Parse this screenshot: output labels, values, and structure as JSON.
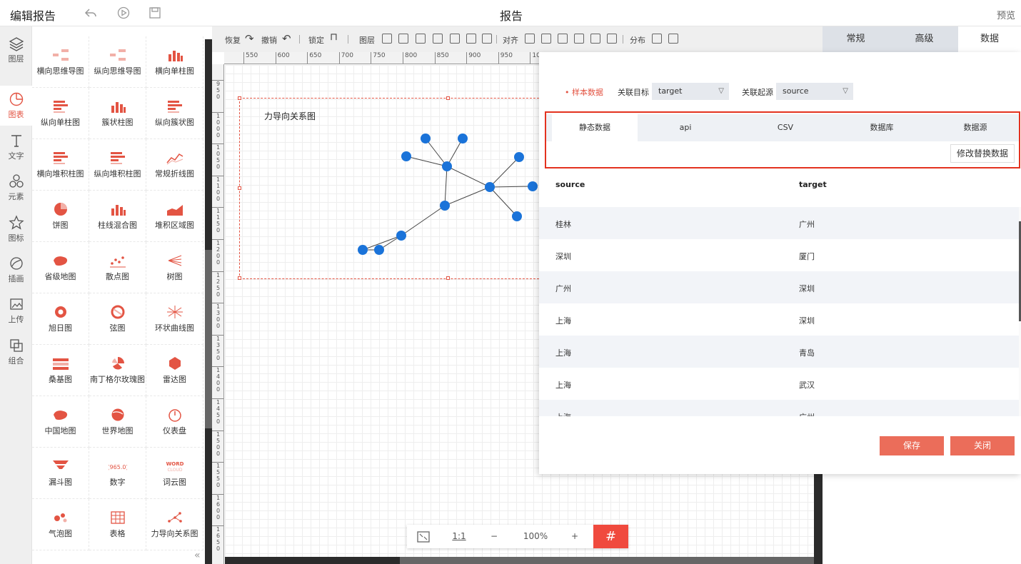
{
  "topbar": {
    "title": "编辑报告",
    "center_title": "报告",
    "preview": "预览"
  },
  "rail": [
    {
      "label": "图层",
      "icon": "layers-icon"
    },
    {
      "label": "图表",
      "icon": "chart-icon",
      "active": true
    },
    {
      "label": "文字",
      "icon": "text-icon"
    },
    {
      "label": "元素",
      "icon": "elements-icon"
    },
    {
      "label": "图标",
      "icon": "star-icon"
    },
    {
      "label": "插画",
      "icon": "illustration-icon"
    },
    {
      "label": "上传",
      "icon": "upload-image-icon"
    },
    {
      "label": "组合",
      "icon": "group-icon"
    }
  ],
  "components": [
    "横向思维导图",
    "纵向思维导图",
    "横向单柱图",
    "纵向单柱图",
    "簇状柱图",
    "纵向簇状图",
    "横向堆积柱图",
    "纵向堆积柱图",
    "常规折线图",
    "饼图",
    "柱线混合图",
    "堆积区域图",
    "省级地图",
    "散点图",
    "树图",
    "旭日图",
    "弦图",
    "环状曲线图",
    "桑基图",
    "南丁格尔玫瑰图",
    "雷达图",
    "中国地图",
    "世界地图",
    "仪表盘",
    "漏斗图",
    "数字",
    "词云图",
    "气泡图",
    "表格",
    "力导向关系图"
  ],
  "toolbar": {
    "redo": "恢复",
    "undo": "撤销",
    "lock": "锁定",
    "layer": "图层",
    "align": "对齐",
    "distribute": "分布"
  },
  "ruler": {
    "top": [
      "550",
      "600",
      "650",
      "700",
      "750",
      "800",
      "850",
      "900",
      "950",
      "10"
    ],
    "left": [
      "950",
      "1000",
      "1050",
      "1100",
      "1150",
      "1200",
      "1250",
      "1300",
      "1350",
      "1400",
      "1450",
      "1500",
      "1550",
      "1600",
      "1650"
    ]
  },
  "widget": {
    "title": "力导向关系图"
  },
  "zoom": {
    "fit": "⤢",
    "ratio": "1:1",
    "minus": "−",
    "level": "100%",
    "plus": "+",
    "grid": "#"
  },
  "right_tabs": [
    "常规",
    "高级",
    "数据"
  ],
  "dialog": {
    "sample_label": "• 样本数据",
    "target_label": "关联目标",
    "target_value": "target",
    "source_label": "关联起源",
    "source_value": "source",
    "source_tabs": [
      "静态数据",
      "api",
      "CSV",
      "数据库",
      "数据源"
    ],
    "modify_button": "修改替换数据",
    "columns": [
      "source",
      "target"
    ],
    "rows": [
      [
        "桂林",
        "广州"
      ],
      [
        "深圳",
        "厦门"
      ],
      [
        "广州",
        "深圳"
      ],
      [
        "上海",
        "深圳"
      ],
      [
        "上海",
        "青岛"
      ],
      [
        "上海",
        "武汉"
      ],
      [
        "上海",
        "广州"
      ]
    ],
    "save": "保存",
    "close": "关闭"
  },
  "colors": {
    "accent": "#e35443",
    "node": "#1a73d9",
    "button": "#eb6d5a"
  }
}
